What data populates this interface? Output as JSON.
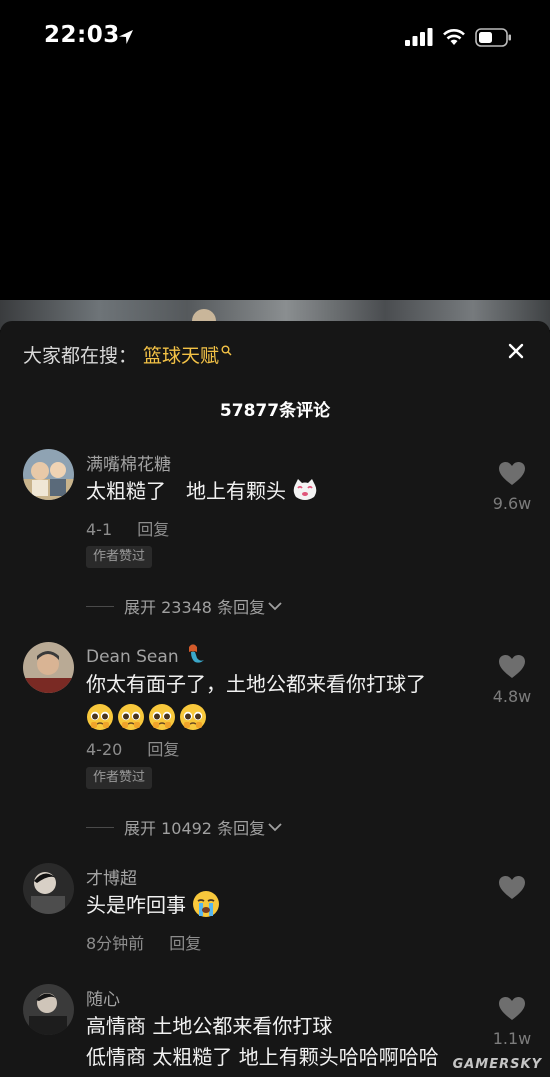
{
  "status_bar": {
    "time": "22:03",
    "icons": [
      "location-arrow-icon",
      "cellular-signal-icon",
      "wifi-icon",
      "battery-icon"
    ]
  },
  "search": {
    "prefix": "大家都在搜：",
    "keyword": "篮球天赋"
  },
  "comments_header": {
    "count_label": "57877条评论"
  },
  "comments": [
    {
      "username": "满嘴棉花糖",
      "content": "太粗糙了　地上有颗头",
      "date": "4-1",
      "reply_label": "回复",
      "badge": "作者赞过",
      "likes": "9.6w",
      "expand_label": "展开 23348 条回复"
    },
    {
      "username": "Dean Sean",
      "content": "你太有面子了，土地公都来看你打球了",
      "date": "4-20",
      "reply_label": "回复",
      "badge": "作者赞过",
      "likes": "4.8w",
      "expand_label": "展开 10492 条回复"
    },
    {
      "username": "才博超",
      "content": "头是咋回事",
      "date": "8分钟前",
      "reply_label": "回复",
      "likes": ""
    },
    {
      "username": "随心",
      "content_lines": [
        "高情商 土地公都来看你打球",
        "低情商 太粗糙了 地上有颗头哈哈啊哈哈"
      ],
      "likes": "1.1w"
    }
  ],
  "watermark": "GAMERSKY",
  "colors": {
    "background": "#161616",
    "keyword": "#f3c246",
    "username": "#a3a3a3",
    "meta": "#8d8d8d"
  }
}
